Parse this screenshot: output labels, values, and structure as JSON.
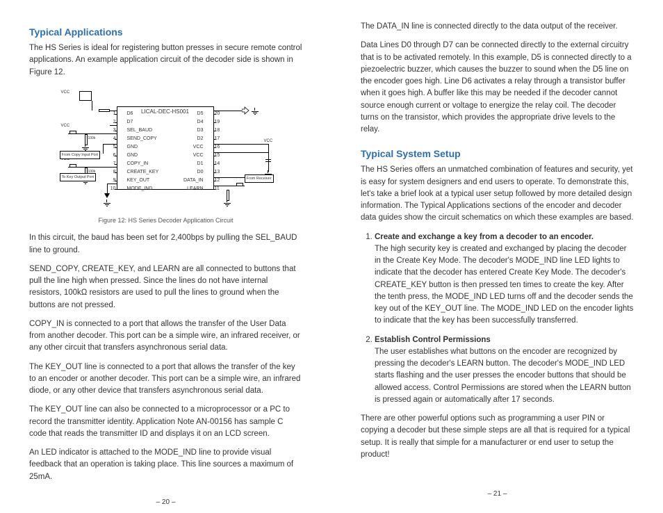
{
  "left": {
    "heading": "Typical Applications",
    "intro": "The HS Series is ideal for registering button presses in secure remote control applications. An example application circuit of the decoder side is shown in Figure 12.",
    "figure_caption": "Figure 12: HS Series Decoder Application Circuit",
    "p1": "In this circuit, the baud has been set for 2,400bps by pulling the SEL_BAUD line to ground.",
    "p2": "SEND_COPY, CREATE_KEY, and LEARN are all connected to buttons that pull the line high when pressed. Since the lines do not have internal resistors, 100kΩ resistors are used to pull the lines to ground when the buttons are not pressed.",
    "p3": "COPY_IN is connected to a port that allows the transfer of the User Data from another decoder. This port can be a simple wire, an infrared receiver, or any other circuit that transfers asynchronous serial data.",
    "p4": "The KEY_OUT line is connected to a port that allows the transfer of the key to an encoder or another decoder. This port can be a simple wire, an infrared diode, or any other device that transfers asynchronous serial data.",
    "p5": "The KEY_OUT line can also be connected to a microprocessor or a PC to record the transmitter identity. Application Note AN-00156 has sample C code that reads the transmitter ID and displays it on an LCD screen.",
    "p6": "An LED indicator is attached to the MODE_IND line to provide visual feedback that an operation is taking place. This line sources a maximum of 25mA.",
    "page": "– 20 –"
  },
  "right": {
    "p1": "The DATA_IN line is connected directly to the data output of the receiver.",
    "p2": "Data Lines D0 through D7 can be connected directly to the external circuitry that is to be activated remotely. In this example, D5 is connected directly to a piezoelectric buzzer, which causes the buzzer to sound when the D5 line on the encoder goes high. Line D6 activates a relay through a transistor buffer when it goes high. A buffer like this may be needed if the decoder cannot source enough current or voltage to energize the relay coil. The decoder turns on the transistor, which provides the appropriate drive levels to the relay.",
    "heading": "Typical System Setup",
    "intro": "The HS Series offers an unmatched combination of features and security, yet is easy for system designers and end users to operate. To demonstrate this, let's take a brief look at a typical user setup followed by more detailed design information. The Typical Applications sections of the encoder and decoder data guides show the circuit schematics on which these examples are based.",
    "li1_title": "Create and exchange a key from a decoder to an encoder.",
    "li1_body": "The high security key is created and exchanged by placing the decoder in the Create Key Mode. The decoder's MODE_IND line LED lights to indicate that the decoder has entered Create Key Mode. The decoder's CREATE_KEY button is then pressed ten times to create the key. After the tenth press, the MODE_IND LED turns off and the decoder sends the key out of the KEY_OUT line. The MODE_IND LED on the encoder lights to indicate that the key has been successfully transferred.",
    "li2_title": "Establish Control Permissions",
    "li2_body": "The user establishes what buttons on the encoder are recognized by pressing the decoder's LEARN button. The decoder's MODE_IND LED starts flashing and the user presses the encoder buttons that should be allowed access. Control Permissions are stored when the LEARN button is pressed again or automatically after 17 seconds.",
    "outro": "There are other powerful options such as programming a user PIN or copying a decoder but these simple steps are all that is required for a typical setup. It is really that simple for a manufacturer or end user to setup the product!",
    "page": "– 21 –"
  },
  "schematic": {
    "chip_name": "LICAL-DEC-HS001",
    "pins_left": [
      {
        "n": "1",
        "name": "D6"
      },
      {
        "n": "2",
        "name": "D7"
      },
      {
        "n": "3",
        "name": "SEL_BAUD"
      },
      {
        "n": "4",
        "name": "SEND_COPY"
      },
      {
        "n": "5",
        "name": "GND"
      },
      {
        "n": "6",
        "name": "GND"
      },
      {
        "n": "7",
        "name": "COPY_IN"
      },
      {
        "n": "8",
        "name": "CREATE_KEY"
      },
      {
        "n": "9",
        "name": "KEY_OUT"
      },
      {
        "n": "10",
        "name": "MODE_IND"
      }
    ],
    "pins_right": [
      {
        "n": "20",
        "name": "D5"
      },
      {
        "n": "19",
        "name": "D4"
      },
      {
        "n": "18",
        "name": "D3"
      },
      {
        "n": "17",
        "name": "D2"
      },
      {
        "n": "16",
        "name": "VCC"
      },
      {
        "n": "15",
        "name": "VCC"
      },
      {
        "n": "14",
        "name": "D1"
      },
      {
        "n": "13",
        "name": "D0"
      },
      {
        "n": "12",
        "name": "DATA_IN"
      },
      {
        "n": "11",
        "name": "LEARN"
      }
    ],
    "port_copy": "From Copy Input Port",
    "port_key": "To Key Output Port",
    "port_rx": "From Receiver",
    "vcc": "VCC",
    "r100k": "100k"
  }
}
